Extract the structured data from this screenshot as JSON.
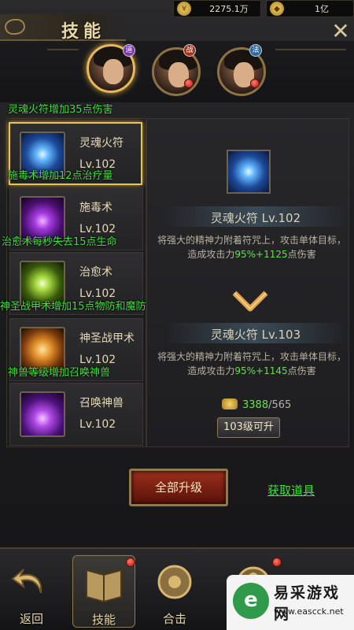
{
  "header": {
    "title": "技能",
    "resources": [
      {
        "icon": "gold-coin-icon",
        "value": "2275.1万"
      },
      {
        "icon": "gold-ingot-icon",
        "value": "1亿"
      }
    ]
  },
  "heroes": [
    {
      "name": "hero-1",
      "tag": "道",
      "tag_color": "#7a3aa8",
      "active": true,
      "red_dot": false
    },
    {
      "name": "hero-2",
      "tag": "战",
      "tag_color": "#a8321c",
      "active": false,
      "red_dot": true
    },
    {
      "name": "hero-3",
      "tag": "法",
      "tag_color": "#2a6aa8",
      "active": false,
      "red_dot": true
    }
  ],
  "notes": [
    "灵魂火符增加35点伤害",
    "施毒术增加12点治疗量",
    "治愈术每秒失去15点生命",
    "神圣战甲术增加15点物防和魔防",
    "神兽等级增加召唤神兽"
  ],
  "skills": [
    {
      "name": "灵魂火符",
      "level": "Lv.102",
      "icon": "soul-talisman-icon",
      "selected": true
    },
    {
      "name": "施毒术",
      "level": "Lv.102",
      "icon": "poison-icon",
      "selected": false
    },
    {
      "name": "治愈术",
      "level": "Lv.102",
      "icon": "heal-icon",
      "selected": false
    },
    {
      "name": "神圣战甲术",
      "level": "Lv.102",
      "icon": "holy-armor-icon",
      "selected": false
    },
    {
      "name": "召唤神兽",
      "level": "Lv.102",
      "icon": "summon-beast-icon",
      "selected": false
    }
  ],
  "detail": {
    "current_title": "灵魂火符 Lv.102",
    "current_desc_pre": "将强大的精神力附着符咒上，攻击单体目标，造成攻击力",
    "current_desc_hl": "95%+1125",
    "current_desc_post": "点伤害",
    "next_title": "灵魂火符 Lv.103",
    "next_desc_pre": "将强大的精神力附着符咒上，攻击单体目标，造成攻击力",
    "next_desc_hl": "95%+1145",
    "next_desc_post": "点伤害",
    "cost_have": "3388",
    "cost_need": "/565",
    "level_req": "103级可升"
  },
  "actions": {
    "upgrade_all": "全部升级",
    "get_items": "获取道具"
  },
  "bottom_nav": {
    "back": "返回",
    "items": [
      {
        "label": "技能",
        "active": true
      },
      {
        "label": "合击",
        "active": false
      }
    ]
  },
  "watermark": {
    "logo": "e",
    "text": "易采游戏网",
    "url": "www.eascck.net"
  },
  "colors": {
    "highlight_green": "#3fe03a",
    "gold_border": "#e7c352",
    "upgrade_red": "#9a2e1c"
  }
}
